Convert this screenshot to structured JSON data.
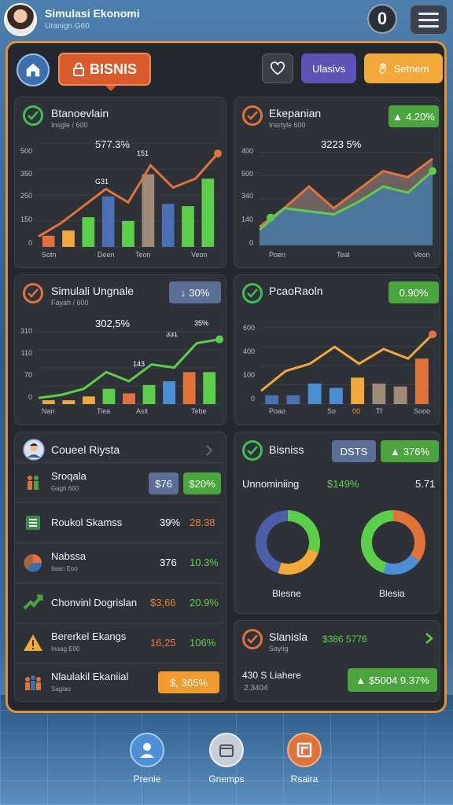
{
  "app": {
    "title": "Simulasi Ekonomi",
    "subtitle": "Uranign G60",
    "coin_value": "0"
  },
  "toolbar": {
    "tab_label": "BISNIS",
    "btn_purple": "Ulasivs",
    "btn_yellow": "Setnem"
  },
  "cards": {
    "c1": {
      "title": "Btanoevlain",
      "sub": "Insgle / 600",
      "peak": "577.3%"
    },
    "c2": {
      "title": "Ekepanian",
      "sub": "Insrtyle 600",
      "badge": "4.20%",
      "peak": "3223 5%"
    },
    "c3": {
      "title": "Simulali Ungnale",
      "sub": "Fayah / 600",
      "badge": "30%",
      "peak": "302,5%",
      "peak2": "35%"
    },
    "c4": {
      "title": "PcaoRaoln",
      "badge": "0.90%"
    },
    "c5": {
      "title": "Bisniss",
      "badge_blue": "DSTS",
      "badge_green": "376%",
      "row_label": "Unnominiing",
      "row_pct": "$149%",
      "row_val": "5.71",
      "donut1_label": "Blesne",
      "donut2_label": "Blesia"
    },
    "c6": {
      "title": "Slanisla",
      "sub": "Sayiig",
      "value": "$386 5776",
      "line1": "430 S Liahere",
      "line2": "2.3404",
      "badge": "$5004 9.37%"
    }
  },
  "list": {
    "header": "Coueel Riysta",
    "rows": [
      {
        "title": "Sroqala",
        "sub": "Gagh 600",
        "v1": "$76",
        "v2": "$20%"
      },
      {
        "title": "Roukol Skamss",
        "v1": "39%",
        "v2": "28.38"
      },
      {
        "title": "Nabssa",
        "sub": "Ilaan Eoo",
        "v1": "376",
        "v2": "10.3%"
      },
      {
        "title": "Chonvinl Dogrislan",
        "v1": "$3,66",
        "v2": "20.9%"
      },
      {
        "title": "Bererkel Ekangs",
        "sub": "Inaag E00",
        "v1": "16,25",
        "v2": "106%"
      },
      {
        "title": "Nlaulakil Ekaniial",
        "sub": "Sagiao",
        "badge": "365%"
      }
    ]
  },
  "nav": {
    "item1": "Prenie",
    "item2": "Gnemps",
    "item3": "Rsaira"
  },
  "colors": {
    "accent_orange": "#e0913a",
    "green": "#4aa53d",
    "panel": "#24272d"
  },
  "chart_data": [
    {
      "type": "bar",
      "title": "Btanoevlain",
      "categories": [
        "Sotn",
        "",
        "",
        "Deen",
        "",
        "",
        "Teon",
        "",
        "Veon"
      ],
      "yticks": [
        "0",
        "150",
        "250",
        "350",
        "500"
      ],
      "series": [
        {
          "values": [
            15,
            22,
            40,
            68,
            35,
            98,
            58,
            55,
            92
          ]
        },
        {
          "values": [
            14,
            32,
            55,
            78,
            60,
            110,
            80,
            92,
            126
          ]
        }
      ],
      "annotations": [
        "577.3%",
        "G31",
        "151"
      ]
    },
    {
      "type": "area",
      "title": "Ekepanian",
      "categories": [
        "Poen",
        "",
        "",
        "Teal",
        "",
        "",
        "Veon"
      ],
      "yticks": [
        "0",
        "140",
        "340",
        "500",
        "400"
      ],
      "series": [
        {
          "values": [
            30,
            60,
            95,
            60,
            90,
            120,
            110,
            140
          ]
        },
        {
          "values": [
            25,
            60,
            55,
            50,
            70,
            95,
            85,
            120
          ]
        }
      ],
      "annotations": [
        "3223 5%"
      ]
    },
    {
      "type": "bar",
      "title": "Simulali Ungnale",
      "categories": [
        "Nan",
        "",
        "",
        "Tiea",
        "",
        "Asit",
        "",
        "Tebe"
      ],
      "yticks": [
        "0",
        "70",
        "110",
        "310"
      ],
      "series": [
        {
          "values": [
            5,
            5,
            10,
            20,
            14,
            25,
            30,
            42,
            42
          ]
        },
        {
          "values": [
            8,
            12,
            20,
            42,
            30,
            52,
            48,
            80,
            85
          ]
        }
      ],
      "annotations": [
        "302,5%",
        "143",
        "331",
        "35%"
      ]
    },
    {
      "type": "bar",
      "title": "PcaoRaoln",
      "categories": [
        "Poao",
        "",
        "So",
        "00",
        "Tf",
        "",
        "Sooo"
      ],
      "yticks": [
        "0",
        "100",
        "400",
        "600"
      ],
      "series": [
        {
          "values": [
            12,
            12,
            28,
            22,
            36,
            28,
            24,
            62
          ]
        },
        {
          "values": [
            18,
            45,
            55,
            78,
            55,
            75,
            62,
            95
          ]
        }
      ]
    },
    {
      "type": "pie",
      "title": "Blesne",
      "series": [
        {
          "values": [
            30,
            25,
            45
          ]
        }
      ]
    },
    {
      "type": "pie",
      "title": "Blesia",
      "series": [
        {
          "values": [
            35,
            20,
            45
          ]
        }
      ]
    }
  ]
}
